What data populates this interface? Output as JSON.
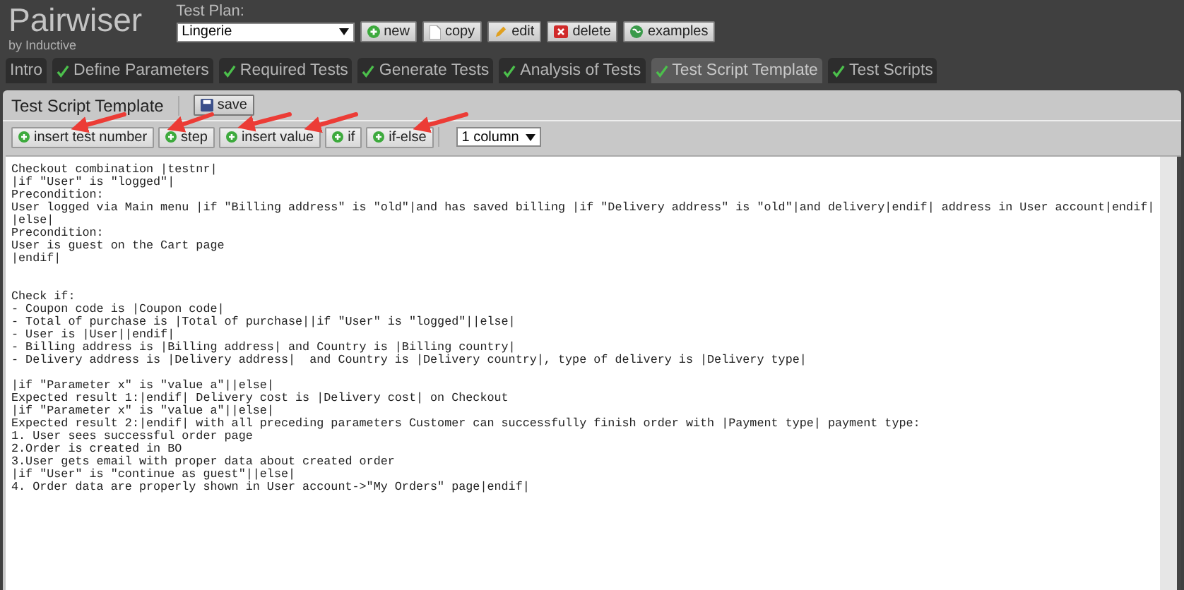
{
  "brand": {
    "name": "Pairwiser",
    "tagline": "by Inductive"
  },
  "test_plan": {
    "label": "Test Plan:",
    "value": "Lingerie"
  },
  "plan_buttons": [
    {
      "label": "new",
      "kind": "add"
    },
    {
      "label": "copy",
      "kind": "copy"
    },
    {
      "label": "edit",
      "kind": "edit"
    },
    {
      "label": "delete",
      "kind": "delete"
    },
    {
      "label": "examples",
      "kind": "examples"
    }
  ],
  "tabs": [
    {
      "label": "Intro",
      "done": false,
      "selected": false
    },
    {
      "label": "Define Parameters",
      "done": true,
      "selected": false
    },
    {
      "label": "Required Tests",
      "done": true,
      "selected": false
    },
    {
      "label": "Generate Tests",
      "done": true,
      "selected": false
    },
    {
      "label": "Analysis of Tests",
      "done": true,
      "selected": false
    },
    {
      "label": "Test Script Template",
      "done": true,
      "selected": true
    },
    {
      "label": "Test Scripts",
      "done": true,
      "selected": false
    }
  ],
  "panel": {
    "title": "Test Script Template",
    "save": "save"
  },
  "insert_buttons": [
    "insert test number",
    "step",
    "insert value",
    "if",
    "if-else"
  ],
  "columns_select": {
    "value": "1 column"
  },
  "editor_lines": [
    {
      "kind": "text",
      "text": "Checkout combination |testnr|"
    },
    {
      "kind": "text",
      "text": "|if \"User\" is \"logged\"|"
    },
    {
      "kind": "text",
      "text": "Precondition:"
    },
    {
      "kind": "text",
      "text": "User logged via Main menu |if \"Billing address\" is \"old\"|and has saved billing |if \"Delivery address\" is \"old\"|and delivery|endif| address in User account|endif|"
    },
    {
      "kind": "text",
      "text": "|else|"
    },
    {
      "kind": "text",
      "text": "Precondition:"
    },
    {
      "kind": "text",
      "text": "User is guest on the Cart page"
    },
    {
      "kind": "text",
      "text": "|endif|"
    },
    {
      "kind": "blank"
    },
    {
      "kind": "blank"
    },
    {
      "kind": "text",
      "text": "Check if:"
    },
    {
      "kind": "text",
      "text": "- Coupon code is |Coupon code|"
    },
    {
      "kind": "text",
      "text": "- Total of purchase is |Total of purchase||if \"User\" is \"logged\"||else|"
    },
    {
      "kind": "text",
      "text": "- User is |User||endif|"
    },
    {
      "kind": "text",
      "text": "- Billing address is |Billing address| and Country is |Billing country|"
    },
    {
      "kind": "text",
      "text": "- Delivery address is |Delivery address|  and Country is |Delivery country|, type of delivery is |Delivery type|"
    },
    {
      "kind": "blank"
    },
    {
      "kind": "text",
      "text": "|if \"Parameter x\" is \"value a\"||else|"
    },
    {
      "kind": "text",
      "text": "Expected result 1:|endif| Delivery cost is |Delivery cost| on Checkout"
    },
    {
      "kind": "text",
      "text": "|if \"Parameter x\" is \"value a\"||else|"
    },
    {
      "kind": "text",
      "text": "Expected result 2:|endif| with all preceding parameters Customer can successfully finish order with |Payment type| payment type:"
    },
    {
      "kind": "text",
      "text": "1. User sees successful order page"
    },
    {
      "kind": "text",
      "text": "2.Order is created in BO"
    },
    {
      "kind": "text",
      "text": "3.User gets email with proper data about created order"
    },
    {
      "kind": "text",
      "text": "|if \"User\" is \"continue as guest\"||else|"
    },
    {
      "kind": "text",
      "text": "4. Order data are properly shown in User account->\"My Orders\" page|endif|"
    }
  ]
}
